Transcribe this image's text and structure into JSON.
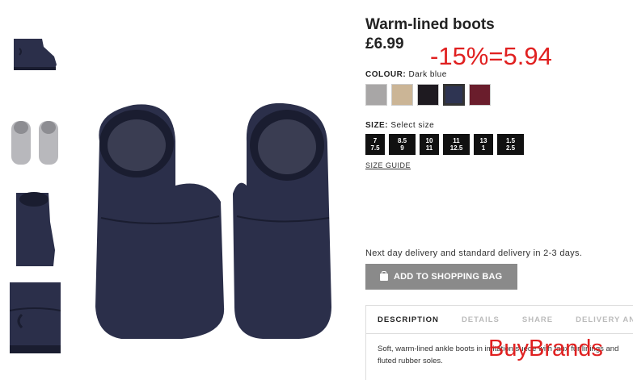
{
  "product": {
    "title": "Warm-lined boots",
    "price": "£6.99",
    "discount_annotation": "-15%=5.94",
    "colour_label": "COLOUR:",
    "colour_value": "Dark blue",
    "colours": [
      {
        "name": "grey",
        "hex": "#a8a6a6",
        "selected": false
      },
      {
        "name": "beige",
        "hex": "#cbb596",
        "selected": false
      },
      {
        "name": "black",
        "hex": "#1e1a20",
        "selected": false
      },
      {
        "name": "dark blue",
        "hex": "#2e3452",
        "selected": true
      },
      {
        "name": "burgundy",
        "hex": "#6a1d2c",
        "selected": false
      }
    ],
    "size_label": "SIZE:",
    "size_value": "Select size",
    "sizes": [
      {
        "line1": "7",
        "line2": "7.5"
      },
      {
        "line1": "8.5",
        "line2": "9"
      },
      {
        "line1": "10",
        "line2": "11"
      },
      {
        "line1": "11",
        "line2": "12.5"
      },
      {
        "line1": "13",
        "line2": "1"
      },
      {
        "line1": "1.5",
        "line2": "2.5"
      }
    ],
    "size_guide": "SIZE GUIDE",
    "delivery_text": "Next day delivery and standard delivery in 2-3 days.",
    "add_to_bag": "ADD TO SHOPPING BAG",
    "tabs": [
      "DESCRIPTION",
      "DETAILS",
      "SHARE",
      "DELIVERY AN"
    ],
    "description": "Soft, warm-lined ankle boots in imitation suede with faux fur linings and fluted rubber soles."
  },
  "watermark": "BuyBrands",
  "colors": {
    "boot": "#2b2f4a",
    "boot_dark": "#1a1d30",
    "lining": "#3a3d52",
    "accent_red": "#e02020",
    "button_grey": "#8a8a8a"
  }
}
